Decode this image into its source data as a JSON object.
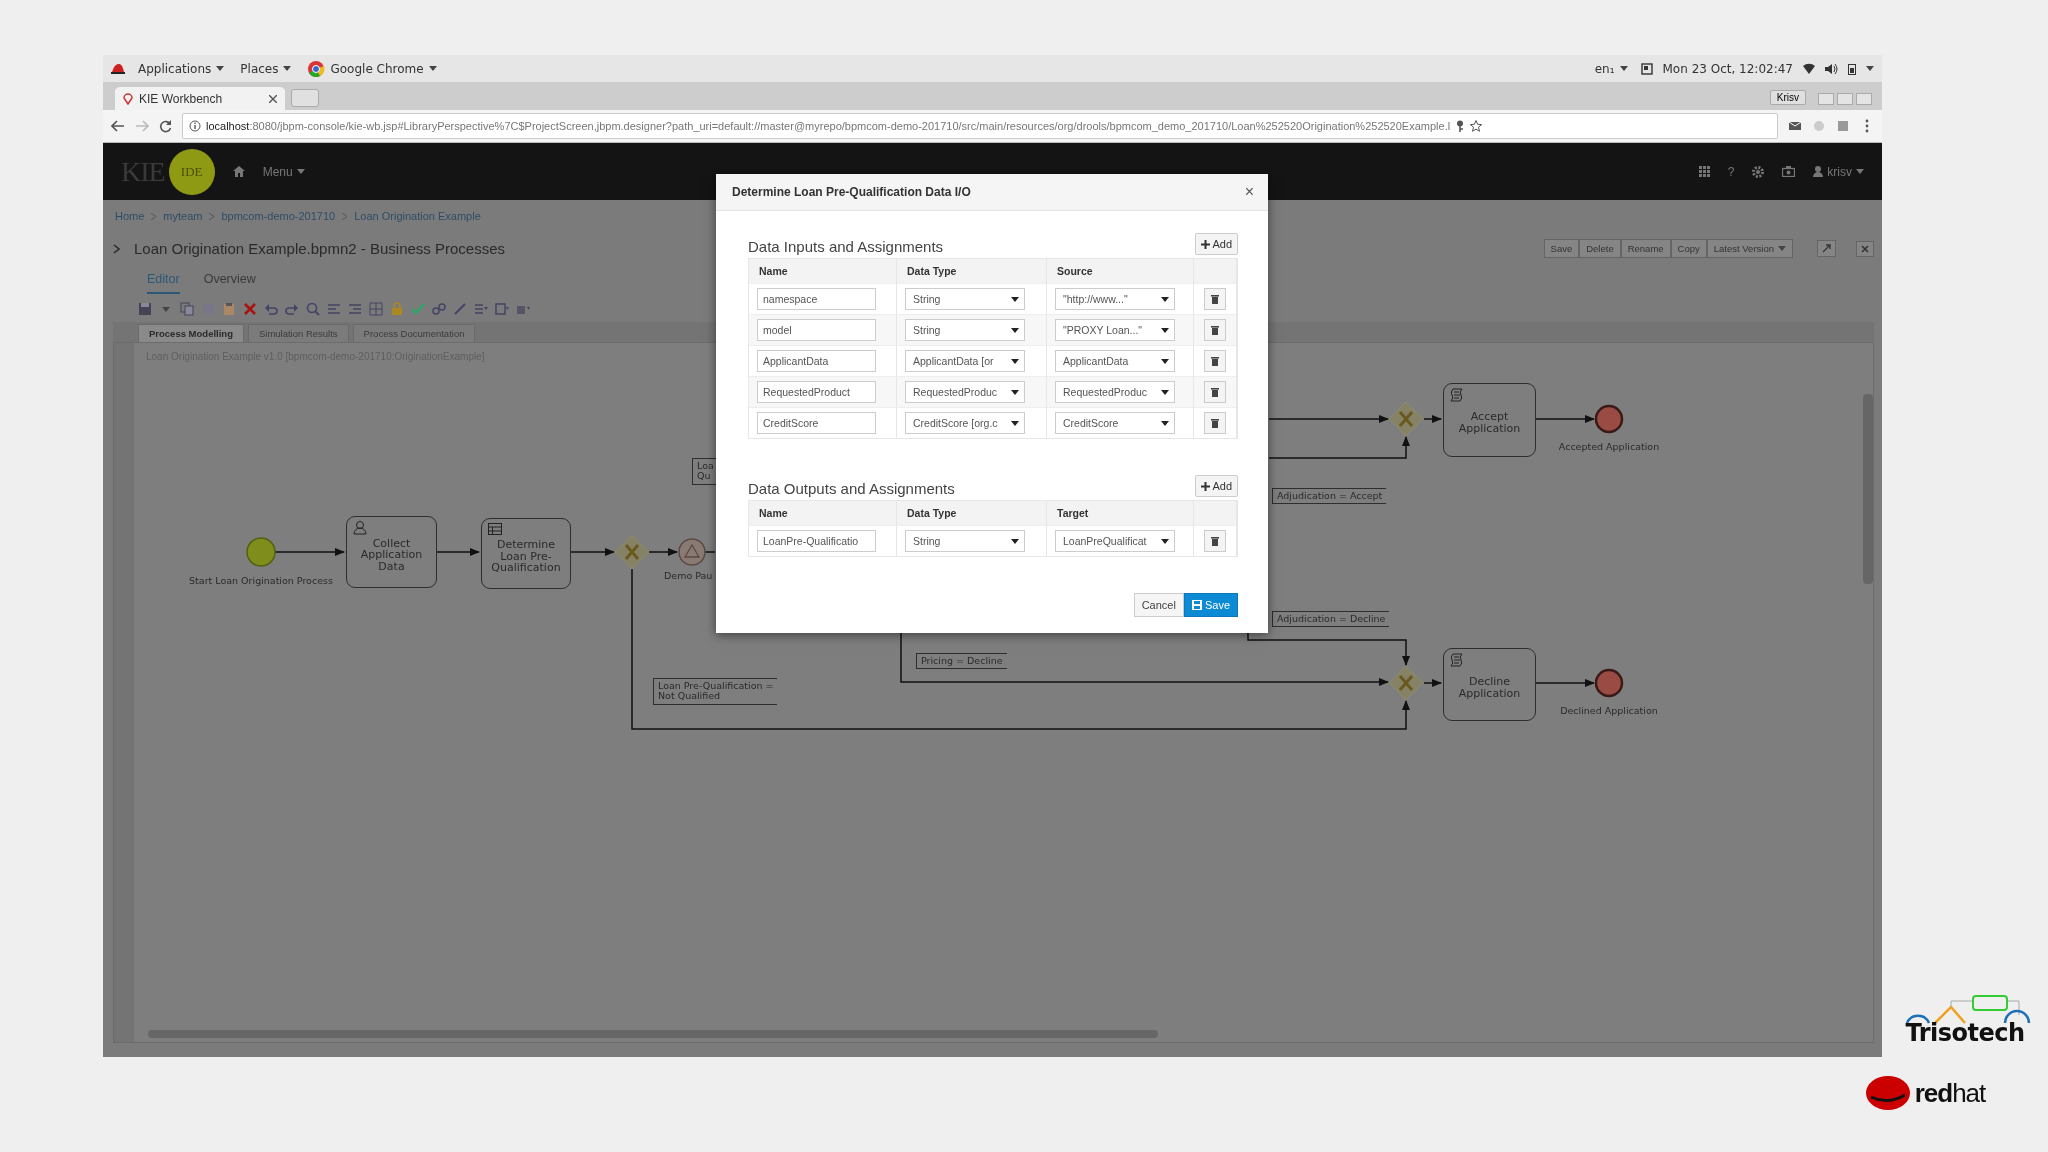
{
  "desktop_bar": {
    "menus": [
      "Applications",
      "Places",
      "Google Chrome"
    ],
    "keyboard": "en₁",
    "clock": "Mon 23 Oct, 12:02:47"
  },
  "browser": {
    "tab": "KIE Workbench",
    "profile": "Krisv",
    "url_host": "localhost",
    "url_path": ":8080/jbpm-console/kie-wb.jsp#LibraryPerspective%7C$ProjectScreen,jbpm.designer?path_uri=default://master@myrepo/bpmcom-demo-201710/src/main/resources/org/drools/bpmcom_demo_201710/Loan%252520Origination%252520Example.l"
  },
  "app_header": {
    "logo": "KIE",
    "logo_badge": "IDE",
    "menu": "Menu",
    "help": "?",
    "user": "krisv"
  },
  "breadcrumbs": [
    "Home",
    "myteam",
    "bpmcom-demo-201710",
    "Loan Origination Example"
  ],
  "document_title": "Loan Origination Example.bpmn2 - Business Processes",
  "actions": [
    "Save",
    "Delete",
    "Rename",
    "Copy",
    "Latest Version"
  ],
  "editor_tabs": [
    {
      "label": "Editor",
      "selected": true
    },
    {
      "label": "Overview",
      "selected": false
    }
  ],
  "designer_tabs": [
    {
      "label": "Process Modelling",
      "selected": true
    },
    {
      "label": "Simulation Results",
      "selected": false
    },
    {
      "label": "Process Documentation",
      "selected": false
    }
  ],
  "canvas_caption": "Loan Origination Example v1.0 [bpmcom-demo-201710:OriginationExample]",
  "diagram": {
    "nodes": [
      {
        "kind": "start",
        "label": "Start Loan Origination Process"
      },
      {
        "kind": "user_task",
        "label": "Collect Application Data"
      },
      {
        "kind": "rule_task",
        "label": "Determine Loan Pre-Qualification"
      },
      {
        "kind": "gateway"
      },
      {
        "kind": "intermediate",
        "label": "Demo Pau"
      },
      {
        "kind": "gateway"
      },
      {
        "kind": "script_task",
        "label": "Accept Application"
      },
      {
        "kind": "end",
        "label": "Accepted Application"
      },
      {
        "kind": "gateway"
      },
      {
        "kind": "script_task",
        "label": "Decline Application"
      },
      {
        "kind": "end",
        "label": "Declined Application"
      }
    ],
    "annotations": [
      [
        "Loa",
        "Qu"
      ],
      [
        "Loan Pre-Qualification =",
        "Not Qualified"
      ],
      [
        "Pricing = Decline"
      ],
      [
        "Adjudication = Accept"
      ],
      [
        "Adjudication = Decline"
      ]
    ]
  },
  "dialog": {
    "title": "Determine Loan Pre-Qualification Data I/O",
    "close": "×",
    "sections": [
      {
        "heading": "Data Inputs and Assignments",
        "add": "Add",
        "columns": [
          "Name",
          "Data Type",
          "Source"
        ],
        "rows": [
          {
            "name": "namespace",
            "data_type": "String",
            "mapping": "\"http://www...\""
          },
          {
            "name": "model",
            "data_type": "String",
            "mapping": "\"PROXY Loan...\""
          },
          {
            "name": "ApplicantData",
            "data_type": "ApplicantData [or",
            "mapping": "ApplicantData"
          },
          {
            "name": "RequestedProduct",
            "data_type": "RequestedProduc",
            "mapping": "RequestedProduc"
          },
          {
            "name": "CreditScore",
            "data_type": "CreditScore [org.c",
            "mapping": "CreditScore"
          }
        ]
      },
      {
        "heading": "Data Outputs and Assignments",
        "add": "Add",
        "columns": [
          "Name",
          "Data Type",
          "Target"
        ],
        "rows": [
          {
            "name": "LoanPre-Qualificatio",
            "data_type": "String",
            "mapping": "LoanPreQualificat"
          }
        ]
      }
    ],
    "cancel": "Cancel",
    "save": "Save"
  },
  "branding": {
    "trisotech": "Trisotech",
    "redhat": "**red**hat"
  }
}
